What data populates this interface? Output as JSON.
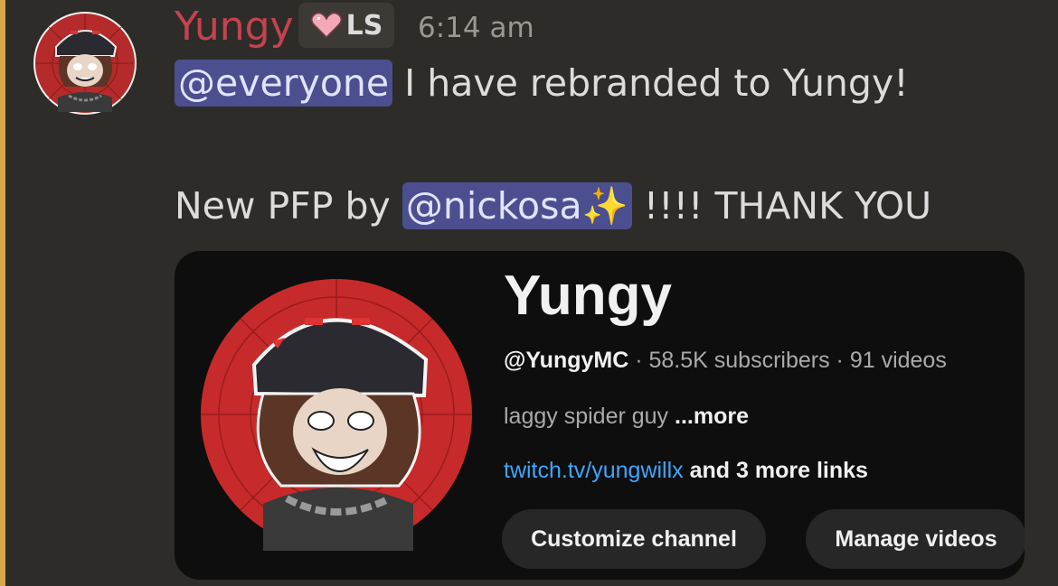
{
  "message": {
    "username": "Yungy",
    "role_tag": "LS",
    "timestamp": "6:14 am",
    "line1_mention": "@everyone",
    "line1_text": " I have rebranded to Yungy!",
    "line2_prefix": "New PFP by ",
    "line2_mention": "@nickosa",
    "line2_sparkle": "✨",
    "line2_suffix": " !!!! THANK YOU"
  },
  "youtube_card": {
    "channel_name": "Yungy",
    "handle": "@YungyMC",
    "meta_rest": " · 58.5K subscribers · 91 videos",
    "description": "laggy spider guy ",
    "description_more": "...more",
    "link": "twitch.tv/yungwillx",
    "more_links": " and 3 more links",
    "button_customize": "Customize channel",
    "button_manage": "Manage videos"
  },
  "colors": {
    "background": "#2e2c28",
    "username": "#c64250",
    "mention_bg": "#4b4f8f",
    "mention_bar": "#d6a64a",
    "card_bg": "#0e0e0e",
    "link": "#3ea6ff"
  },
  "icons": {
    "avatar": "spider-character-avatar",
    "role_icon": "pink-heart-icon"
  }
}
